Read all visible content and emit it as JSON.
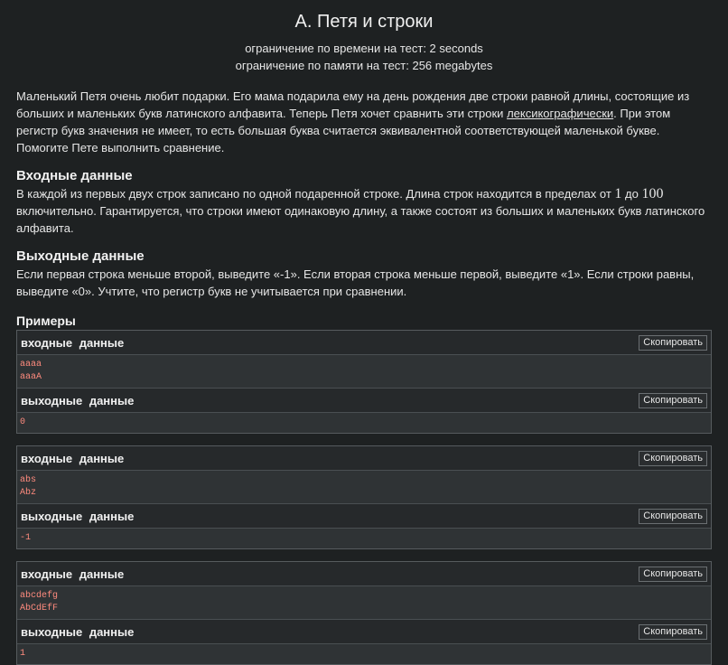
{
  "problem": {
    "title": "A. Петя и строки",
    "time_limit": "ограничение по времени на тест: 2 seconds",
    "memory_limit": "ограничение по памяти на тест: 256 megabytes",
    "legend_part1": "Маленький Петя очень любит подарки. Его мама подарила ему на день рождения две строки равной длины, состоящие из больших и маленьких букв латинского алфавита. Теперь Петя хочет сравнить эти строки ",
    "legend_link": "лексикографически",
    "legend_part2": ". При этом регистр букв значения не имеет, то есть большая буква считается эквивалентной соответствующей маленькой букве. Помогите Пете выполнить сравнение.",
    "input_title": "Входные данные",
    "input_part1": "В каждой из первых двух строк записано по одной подаренной строке. Длина строк находится в пределах от ",
    "input_min": "1",
    "input_to": " до ",
    "input_max": "100",
    "input_part2": " включительно. Гарантируется, что строки имеют одинаковую длину, а также состоят из больших и маленьких букв латинского алфавита.",
    "output_title": "Выходные данные",
    "output_text": "Если первая строка меньше второй, выведите «-1». Если вторая строка меньше первой, выведите «1». Если строки равны, выведите «0». Учтите, что регистр букв не учитывается при сравнении.",
    "examples_title": "Примеры"
  },
  "io_labels": {
    "input": "входные данные",
    "output": "выходные данные",
    "copy": "Скопировать"
  },
  "examples": [
    {
      "input": [
        "aaaa",
        "aaaA"
      ],
      "output": [
        "0"
      ]
    },
    {
      "input": [
        "abs",
        "Abz"
      ],
      "output": [
        "-1"
      ]
    },
    {
      "input": [
        "abcdefg",
        "AbCdEfF"
      ],
      "output": [
        "1"
      ]
    }
  ]
}
